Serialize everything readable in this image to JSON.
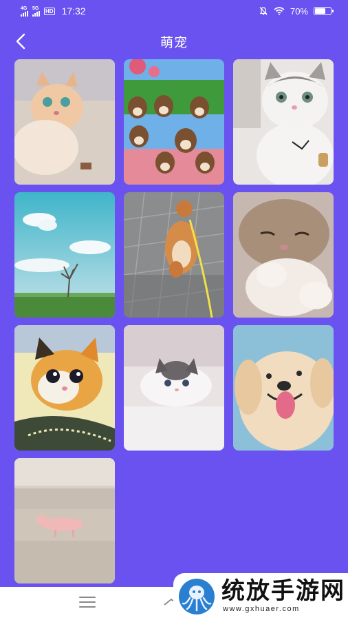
{
  "status_bar": {
    "network_1": "4G",
    "network_2": "5G",
    "hd_badge": "HD",
    "time": "17:32",
    "battery": "70%",
    "battery_level": 0.7
  },
  "header": {
    "title": "萌宠",
    "back_icon": "chevron-left-icon"
  },
  "gallery": {
    "items": [
      {
        "name": "cat-kitten-teal-eyes-image"
      },
      {
        "name": "dogs-meme-collage-image"
      },
      {
        "name": "white-gray-cat-image"
      },
      {
        "name": "sky-tree-landscape-image"
      },
      {
        "name": "corgi-walking-image"
      },
      {
        "name": "sleepy-cat-image"
      },
      {
        "name": "cartoon-kitten-image"
      },
      {
        "name": "ragdoll-cat-image"
      },
      {
        "name": "puppy-tongue-image"
      },
      {
        "name": "piglet-couch-image"
      }
    ]
  },
  "nav_bar": {
    "menu_icon": "menu-icon",
    "home_icon": "home-icon"
  },
  "watermark": {
    "text": "统放手游网",
    "url": "www.gxhuaer.com"
  }
}
